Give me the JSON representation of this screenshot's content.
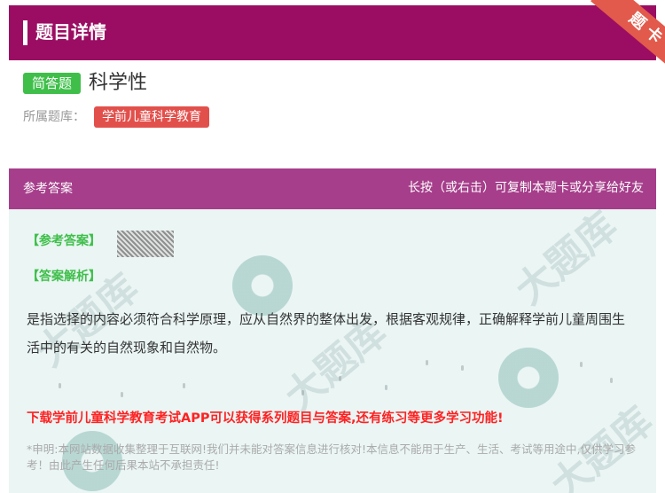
{
  "header": {
    "title": "题目详情",
    "ribbon": "题卡"
  },
  "question": {
    "type_tag": "简答题",
    "title": "科学性",
    "bank_label": "所属题库：",
    "bank_name": "学前儿童科学教育"
  },
  "answer_header": {
    "left": "参考答案",
    "right": "长按（或右击）可复制本题卡或分享给好友"
  },
  "answer": {
    "ref_label": "【参考答案】",
    "analysis_label": "【答案解析】",
    "explanation": "是指选择的内容必须符合科学原理，应从自然界的整体出发，根据客观规律，正确解释学前儿童周围生活中的有关的自然现象和自然物。",
    "promo": "下载学前儿童科学教育考试APP可以获得系列题目与答案,还有练习等更多学习功能!",
    "disclaimer": "*申明:本网站数据收集整理于互联网!我们并未能对答案信息进行核对!本信息不能用于生产、生活、考试等用途中,仅供学习参考！由此产生任何后果本站不承担责任!"
  },
  "colors": {
    "header_bg": "#9b0d63",
    "answer_header_bg": "#a63e8b",
    "tag_green": "#3fbf4a",
    "tag_red": "#e2504c",
    "promo_red": "#ff2222"
  }
}
